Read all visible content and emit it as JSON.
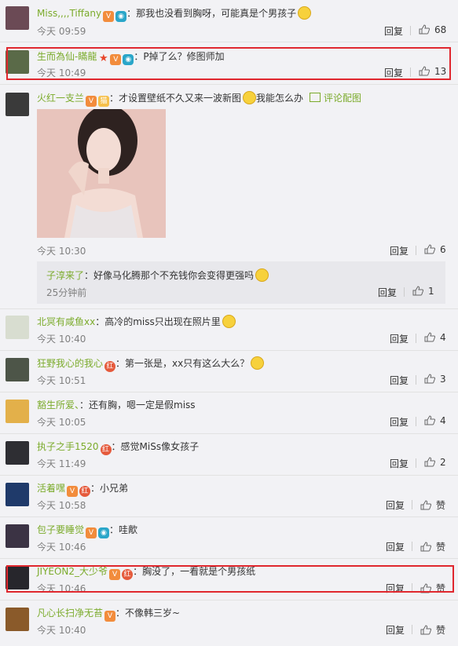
{
  "comments": [
    {
      "name": "Miss,,,,Tiffany",
      "text": "：那我也没看到胸呀，可能真是个男孩子",
      "time": "今天 09:59",
      "reply": "回复",
      "likes": "68"
    },
    {
      "name": "生而為仙-瞞龍",
      "text": "：P掉了么？修图师加",
      "time": "今天 10:49",
      "reply": "回复",
      "likes": "13"
    },
    {
      "name": "火红一支兰",
      "text": "：才设置壁纸不久又来一波新图",
      "text2": "我能怎么办",
      "extra": "评论配图",
      "time": "今天 10:30",
      "reply": "回复",
      "likes": "6"
    },
    {
      "name": "北冥有咸鱼xx",
      "text": "：高冷的miss只出现在照片里",
      "time": "今天 10:40",
      "reply": "回复",
      "likes": "4"
    },
    {
      "name": "狂野我心的我心",
      "text": "：第一张是，xx只有这么大么？",
      "time": "今天 10:51",
      "reply": "回复",
      "likes": "3"
    },
    {
      "name": "豁生所爱、",
      "text": "：还有胸，嗯一定是假miss",
      "time": "今天 10:05",
      "reply": "回复",
      "likes": "4"
    },
    {
      "name": "执子之手1520",
      "text": "：感觉MiSs像女孩子",
      "time": "今天 11:49",
      "reply": "回复",
      "likes": "2"
    },
    {
      "name": "活着嘿",
      "text": "：小兄弟",
      "time": "今天 10:58",
      "reply": "回复",
      "likes": "赞"
    },
    {
      "name": "包子要睡觉",
      "text": "：哇歒",
      "time": "今天 10:46",
      "reply": "回复",
      "likes": "赞"
    },
    {
      "name": "JIYEON2_大少爷",
      "text": "：胸没了，一看就是个男孩纸",
      "time": "今天 10:46",
      "reply": "回复",
      "likes": "赞"
    },
    {
      "name": "凡心长扫净无苔",
      "text": "：不像韩三岁~",
      "time": "今天 10:40",
      "reply": "回复",
      "likes": "赞"
    }
  ],
  "subreply": {
    "name": "子淳来了",
    "text": "：好像马化腾那个不充钱你会变得更强吗",
    "time": "25分钟前",
    "reply": "回复",
    "likes": "1"
  },
  "badges": {
    "vip": "V",
    "cam": "◉",
    "red": "红",
    "cat": "猫",
    "star": "★"
  },
  "colors": {
    "username": "#7bab2b",
    "highlight": "#e0272e",
    "background": "#f2f2f5"
  }
}
